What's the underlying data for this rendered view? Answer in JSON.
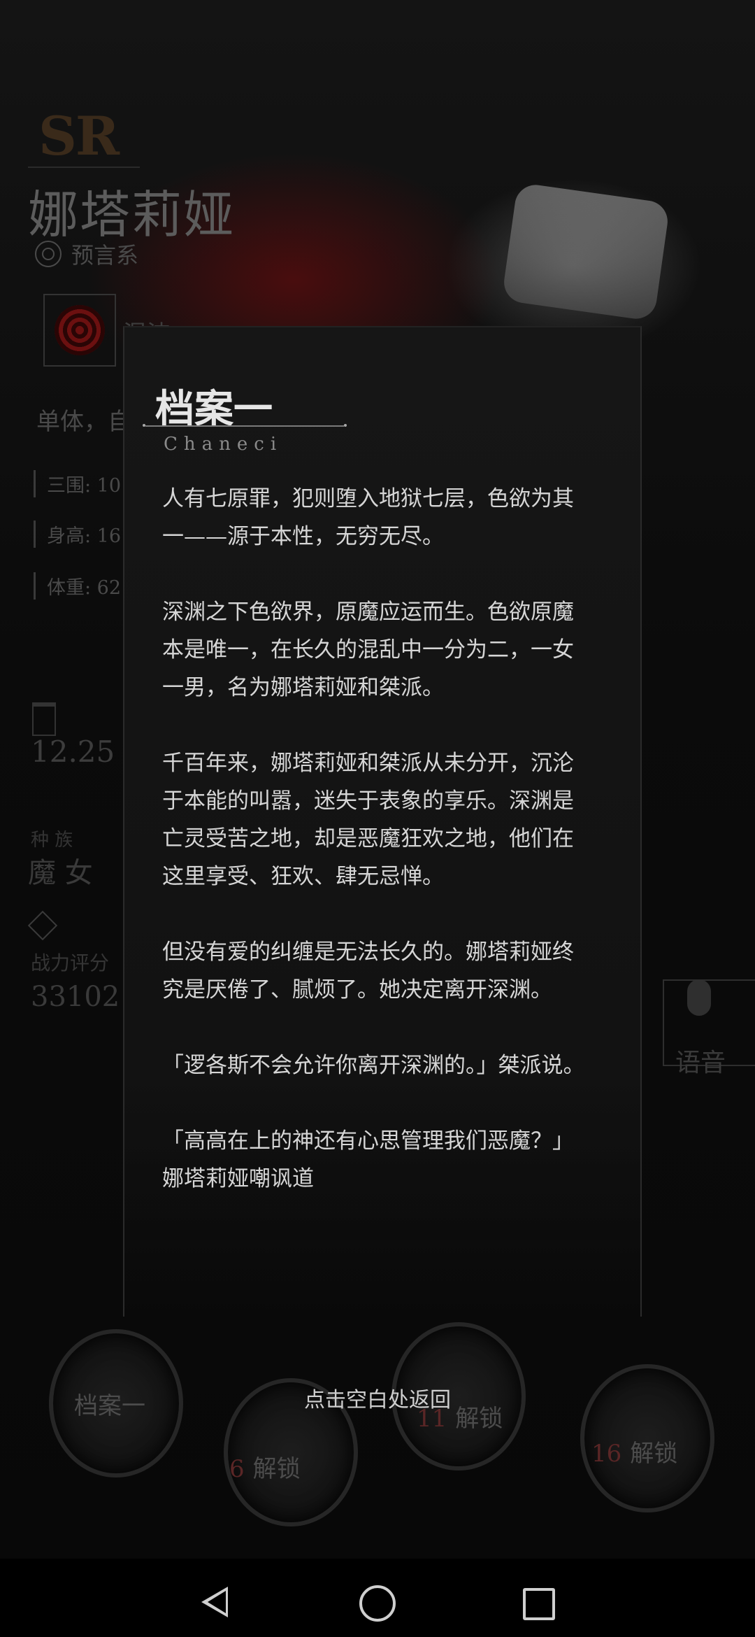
{
  "background": {
    "rarity": "SR",
    "character_name": "娜塔莉娅",
    "faction": "预言系",
    "skill_name": "混沌",
    "target_text": "单体，自",
    "stats": [
      "三围: 10",
      "身高: 16",
      "体重: 62"
    ],
    "birthday": "12.25",
    "race_label": "种    族",
    "race_value": "魔    女",
    "power_label": "战力评分",
    "power_value": "33102",
    "voice_label": "语音"
  },
  "modal": {
    "title": "档案一",
    "subtitle": "Chaneci",
    "paragraphs": [
      "人有七原罪，犯则堕入地狱七层，色欲为其一——源于本性，无穷无尽。",
      "深渊之下色欲界，原魔应运而生。色欲原魔本是唯一，在长久的混乱中一分为二，一女一男，名为娜塔莉娅和桀派。",
      "千百年来，娜塔莉娅和桀派从未分开，沉沦于本能的叫嚣，迷失于表象的享乐。深渊是亡灵受苦之地，却是恶魔狂欢之地，他们在这里享受、狂欢、肆无忌惮。",
      "但没有爱的纠缠是无法长久的。娜塔莉娅终究是厌倦了、腻烦了。她决定离开深渊。",
      "「逻各斯不会允许你离开深渊的。」桀派说。",
      "「高高在上的神还有心思管理我们恶魔？」娜塔莉娅嘲讽道"
    ],
    "hint": "点击空白处返回"
  },
  "archives": {
    "first_label": "档案一",
    "locks": [
      {
        "num": "6",
        "label": "解锁"
      },
      {
        "num": "11",
        "label": "解锁"
      },
      {
        "num": "16",
        "label": "解锁"
      }
    ]
  },
  "icons": [
    "faction-icon",
    "chaos-skill-icon",
    "birthday-cake-icon",
    "power-diamond-icon",
    "microphone-icon",
    "nav-back-icon",
    "nav-home-icon",
    "nav-recent-icon"
  ]
}
